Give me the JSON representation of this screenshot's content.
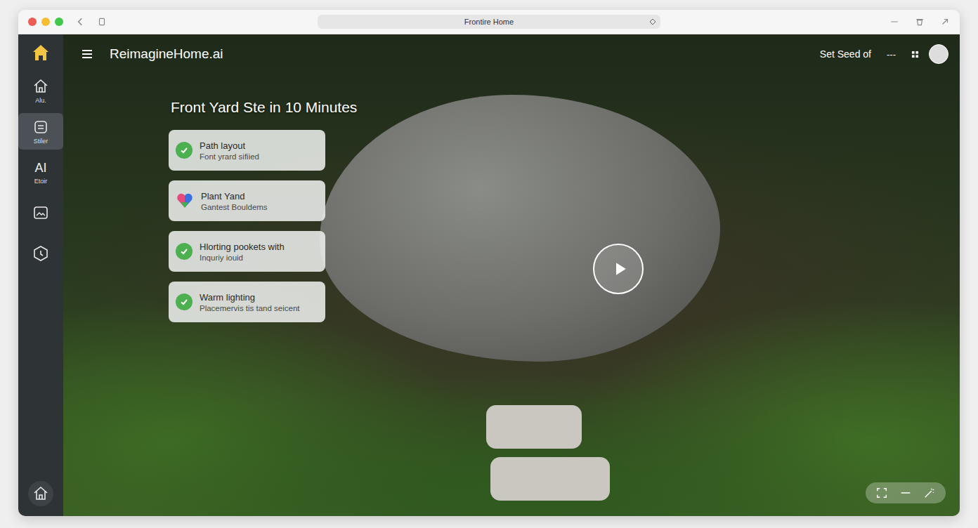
{
  "window": {
    "title": "Frontire Home"
  },
  "app": {
    "brand": "ReimagineHome.ai"
  },
  "topbar": {
    "seed_label": "Set Seed of",
    "more": "---"
  },
  "sidebar": {
    "items": [
      {
        "kind": "home",
        "label": "Alu.",
        "selected": false
      },
      {
        "kind": "layers",
        "label": "Stiler",
        "selected": true
      },
      {
        "kind": "glyph",
        "glyph": "AI",
        "label": "Etoir",
        "selected": false
      },
      {
        "kind": "image",
        "selected": false
      },
      {
        "kind": "clock",
        "selected": false
      }
    ]
  },
  "hero": {
    "title": "Front Yard Ste in 10 Minutes"
  },
  "steps": [
    {
      "kind": "check",
      "checked": true,
      "title": "Path layout",
      "subtitle": "Font yrard sifiied"
    },
    {
      "kind": "heart",
      "checked": false,
      "title": "Plant Yand",
      "subtitle": "Gantest Bouldems"
    },
    {
      "kind": "check",
      "checked": true,
      "title": "Hlorting pookets with",
      "subtitle": "Inquriy iouid"
    },
    {
      "kind": "check",
      "checked": true,
      "title": "Warm lighting",
      "subtitle": "Placemervis tis tand seicent"
    }
  ]
}
